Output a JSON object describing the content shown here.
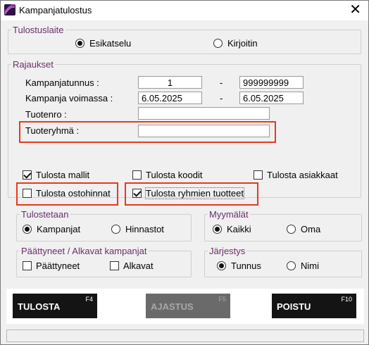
{
  "window": {
    "title": "Kampanjatulostus",
    "close_glyph": "✕"
  },
  "tulostuslaite": {
    "legend": "Tulostuslaite",
    "options": [
      {
        "label": "Esikatselu",
        "selected": true
      },
      {
        "label": "Kirjoitin",
        "selected": false
      }
    ]
  },
  "rajaukset": {
    "legend": "Rajaukset",
    "kampanjatunnus": {
      "label": "Kampanjatunnus :",
      "from": "1",
      "separator": "-",
      "to": "999999999"
    },
    "voimassa": {
      "label": "Kampanja voimassa :",
      "from": "6.05.2025",
      "separator": "-",
      "to": "6.05.2025"
    },
    "tuotenro": {
      "label": "Tuotenro :",
      "value": ""
    },
    "tuoteryhma": {
      "label": "Tuoteryhmä :",
      "value": ""
    }
  },
  "options": {
    "tulosta_mallit": {
      "label": "Tulosta mallit",
      "checked": true
    },
    "tulosta_koodit": {
      "label": "Tulosta koodit",
      "checked": false
    },
    "tulosta_asiakkaat": {
      "label": "Tulosta asiakkaat",
      "checked": false
    },
    "tulosta_ostohinnat": {
      "label": "Tulosta ostohinnat",
      "checked": false
    },
    "tulosta_ryhmien_tuotteet": {
      "label": "Tulosta ryhmien tuotteet",
      "checked": true
    }
  },
  "tulostetaan": {
    "legend": "Tulostetaan",
    "options": [
      {
        "label": "Kampanjat",
        "selected": true
      },
      {
        "label": "Hinnastot",
        "selected": false
      }
    ]
  },
  "myymalat": {
    "legend": "Myymälät",
    "options": [
      {
        "label": "Kaikki",
        "selected": true
      },
      {
        "label": "Oma",
        "selected": false
      }
    ]
  },
  "paattyneet": {
    "legend": "Päättyneet / Alkavat kampanjat",
    "options": [
      {
        "label": "Päättyneet",
        "checked": false
      },
      {
        "label": "Alkavat",
        "checked": false
      }
    ]
  },
  "jarjestys": {
    "legend": "Järjestys",
    "options": [
      {
        "label": "Tunnus",
        "selected": true
      },
      {
        "label": "Nimi",
        "selected": false
      }
    ]
  },
  "function_bar": {
    "tulosta": {
      "label": "TULOSTA",
      "key": "F4",
      "enabled": true
    },
    "ajastus": {
      "label": "AJASTUS",
      "key": "F5",
      "enabled": false
    },
    "poistu": {
      "label": "POISTU",
      "key": "F10",
      "enabled": true
    }
  },
  "colors": {
    "accent": "#6a2e6a",
    "highlight": "#e8391c",
    "button": "#141414"
  }
}
